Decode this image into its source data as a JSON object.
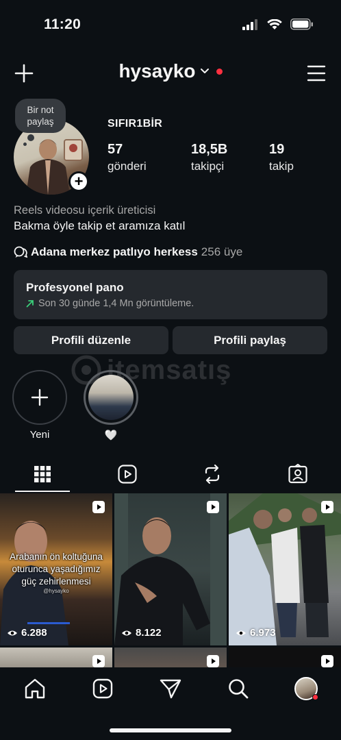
{
  "status_bar": {
    "time": "11:20"
  },
  "header": {
    "username": "hysayko"
  },
  "note": {
    "line1": "Bir not",
    "line2": "paylaş"
  },
  "profile": {
    "display_name": "SIFIR1BİR",
    "stats": [
      {
        "value": "57",
        "label": "gönderi"
      },
      {
        "value": "18,5B",
        "label": "takipçi"
      },
      {
        "value": "19",
        "label": "takip"
      }
    ],
    "category": "Reels videosu içerik üreticisi",
    "bio": "Bakma öyle takip et aramıza katıl"
  },
  "channel": {
    "name": "Adana merkez patlıyo herkess",
    "members": "256 üye"
  },
  "dashboard": {
    "title": "Profesyonel pano",
    "subtitle": "Son 30 günde 1,4 Mn görüntüleme."
  },
  "buttons": {
    "edit_profile": "Profili düzenle",
    "share_profile": "Profili paylaş"
  },
  "watermark": "itemsatış",
  "highlights": [
    {
      "label": "Yeni"
    },
    {
      "label": "🤍"
    }
  ],
  "posts": [
    {
      "views": "6.288",
      "caption": "Arabanın ön koltuğuna oturunca yaşadığımız güç zehirlenmesi",
      "handle": "@hysayko"
    },
    {
      "views": "8.122"
    },
    {
      "views": "6.973"
    }
  ],
  "colors": {
    "background": "#0c1014",
    "card": "#25292e",
    "accent_red": "#ff3040",
    "accent_green": "#3ad07a"
  }
}
